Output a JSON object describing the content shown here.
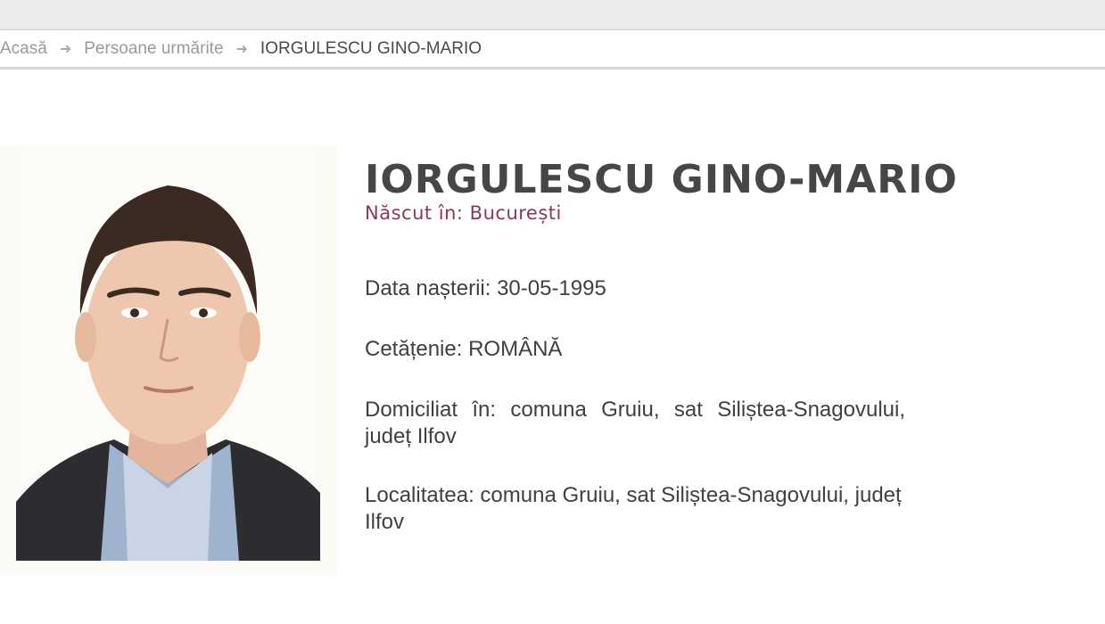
{
  "breadcrumb": {
    "home": "Acasă",
    "section": "Persoane urmărite",
    "current": "IORGULESCU GINO-MARIO"
  },
  "profile": {
    "name": "IORGULESCU GINO-MARIO",
    "born_in": "Născut în: București",
    "birth_date": "Data nașterii: 30-05-1995",
    "citizenship": "Cetățenie: ROMÂNĂ",
    "domicile": "Domiciliat în: comuna Gruiu, sat Siliștea-Snagovului, județ Ilfov",
    "locality": "Localitatea: comuna Gruiu, sat Siliștea-Snagovului, județ Ilfov"
  },
  "colors": {
    "accent": "#8a3a55",
    "title": "#454648",
    "text": "#404040"
  }
}
